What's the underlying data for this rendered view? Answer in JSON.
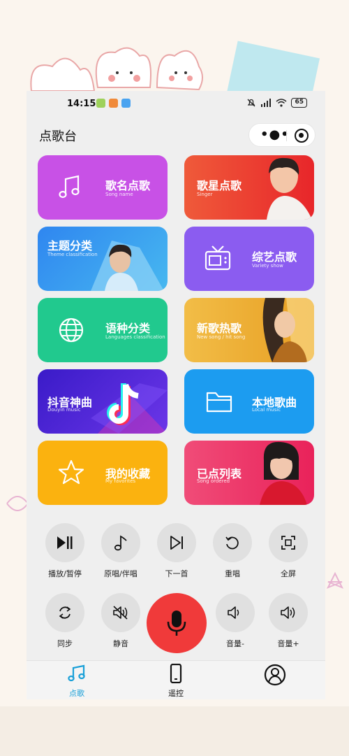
{
  "status_bar": {
    "time": "14:15",
    "battery": "65"
  },
  "header": {
    "title": "点歌台"
  },
  "cards": [
    {
      "cn": "歌名点歌",
      "en": "Song name",
      "icon": "music-note-icon",
      "color": "#c851e6"
    },
    {
      "cn": "歌星点歌",
      "en": "Singer",
      "icon": "singer-photo",
      "color": "#ee4a32"
    },
    {
      "cn": "主题分类",
      "en": "Theme classification",
      "icon": "theme-photo",
      "color": "#3a8fe8"
    },
    {
      "cn": "综艺点歌",
      "en": "Variety show",
      "icon": "tv-icon",
      "color": "#8b5cf0"
    },
    {
      "cn": "语种分类",
      "en": "Languages classification",
      "icon": "globe-icon",
      "color": "#21c98e"
    },
    {
      "cn": "新歌热歌",
      "en": "New song / hit song",
      "icon": "new-song-photo",
      "color": "#eeb13a"
    },
    {
      "cn": "抖音神曲",
      "en": "Douyin music",
      "icon": "douyin-icon",
      "color": "#4b2bd6"
    },
    {
      "cn": "本地歌曲",
      "en": "Local music",
      "icon": "folder-icon",
      "color": "#1c9cf0"
    },
    {
      "cn": "我的收藏",
      "en": "My favorites",
      "icon": "star-icon",
      "color": "#fbb20f"
    },
    {
      "cn": "已点列表",
      "en": "Song ordered",
      "icon": "ordered-photo",
      "color": "#ef3a67"
    }
  ],
  "controls": {
    "play_pause": "播放/暂停",
    "original_accompany": "原唱/伴唱",
    "next": "下一首",
    "replay": "重唱",
    "fullscreen": "全屏",
    "sync": "同步",
    "mute": "静音",
    "vol_down": "音量-",
    "vol_up": "音量+"
  },
  "tabs": [
    {
      "label": "点歌",
      "active": true,
      "color": "#1aa0d8"
    },
    {
      "label": "遥控",
      "active": false,
      "color": "#111111"
    }
  ]
}
